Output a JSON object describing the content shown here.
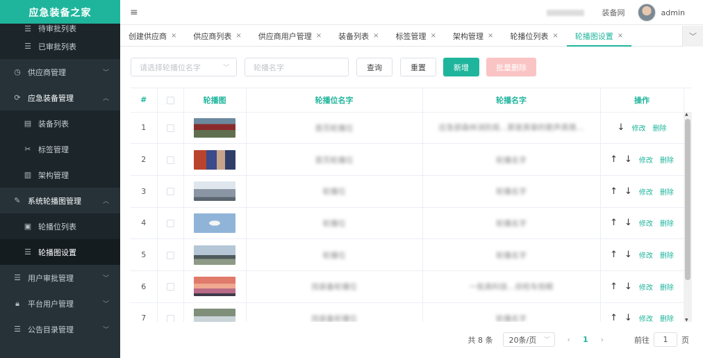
{
  "app": {
    "title": "应急装备之家"
  },
  "sidebar": {
    "items": [
      {
        "label": "待审批列表",
        "icon": "list-icon",
        "level": "sub"
      },
      {
        "label": "已审批列表",
        "icon": "list-icon",
        "level": "sub"
      },
      {
        "label": "供应商管理",
        "icon": "clock-icon",
        "level": "top"
      },
      {
        "label": "应急装备管理",
        "icon": "refresh-icon",
        "level": "top"
      },
      {
        "label": "装备列表",
        "icon": "document-icon",
        "level": "sub"
      },
      {
        "label": "标签管理",
        "icon": "tag-icon",
        "level": "sub"
      },
      {
        "label": "架构管理",
        "icon": "bar-chart-icon",
        "level": "sub"
      },
      {
        "label": "系统轮播图管理",
        "icon": "edit-icon",
        "level": "top"
      },
      {
        "label": "轮播位列表",
        "icon": "image-icon",
        "level": "sub"
      },
      {
        "label": "轮播图设置",
        "icon": "list-icon",
        "level": "sub"
      },
      {
        "label": "用户审批管理",
        "icon": "list-icon",
        "level": "top"
      },
      {
        "label": "平台用户管理",
        "icon": "lock-icon",
        "level": "top"
      },
      {
        "label": "公告目录管理",
        "icon": "list-icon",
        "level": "top"
      }
    ]
  },
  "header": {
    "site_link": "装备网",
    "user": "admin"
  },
  "tabs": [
    "创建供应商",
    "供应商列表",
    "供应商用户管理",
    "装备列表",
    "标签管理",
    "架构管理",
    "轮播位列表",
    "轮播图设置"
  ],
  "toolbar": {
    "select_placeholder": "请选择轮播位名字",
    "input_placeholder": "轮播名字",
    "query": "查询",
    "reset": "重置",
    "add": "新增",
    "batch_delete": "批量删除"
  },
  "table": {
    "headers": [
      "#",
      "",
      "轮播图",
      "轮播位名字",
      "轮播名字",
      "操作"
    ],
    "rows": [
      {
        "num": "1",
        "position": "首页轮播位",
        "name": "应急部森林消防局…那是真挚的歌声真情…"
      },
      {
        "num": "2",
        "position": "首页轮播位",
        "name": "轮播名字"
      },
      {
        "num": "3",
        "position": "轮播位",
        "name": "轮播名字"
      },
      {
        "num": "4",
        "position": "轮播位",
        "name": "轮播名字"
      },
      {
        "num": "5",
        "position": "轮播位",
        "name": "轮播名字"
      },
      {
        "num": "6",
        "position": "找装备轮播位",
        "name": "一批高科技…侦检车抢眼"
      },
      {
        "num": "7",
        "position": "找装备轮播位",
        "name": "轮播名字"
      }
    ],
    "edit": "修改",
    "delete": "删除"
  },
  "pagination": {
    "total": "共 8 条",
    "page_size": "20条/页",
    "current": "1",
    "goto_label": "前往",
    "goto_value": "1",
    "unit": "页"
  }
}
